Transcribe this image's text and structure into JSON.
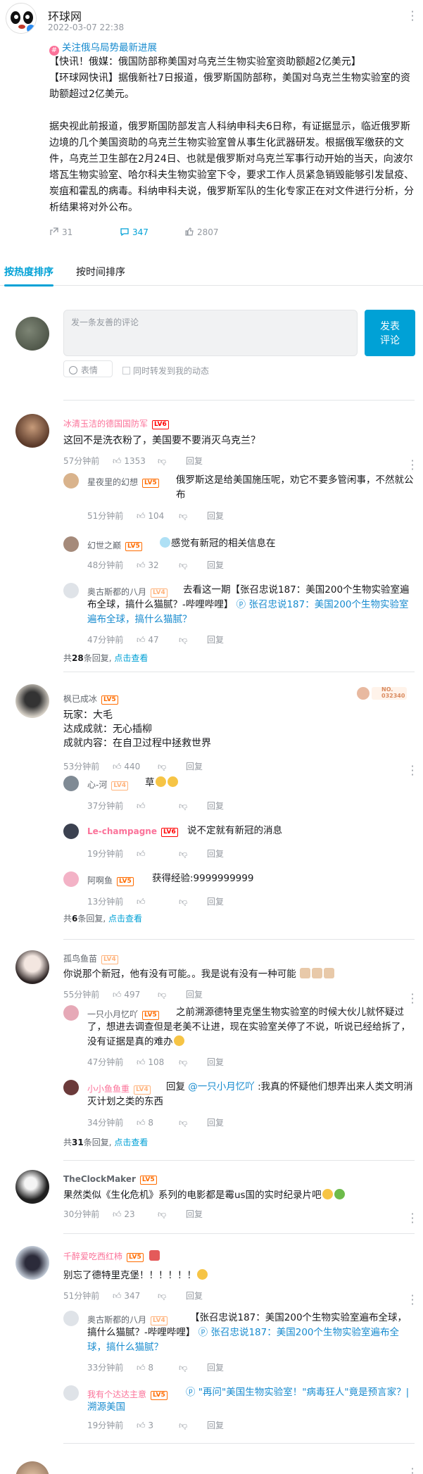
{
  "post": {
    "author": "环球网",
    "time": "2022-03-07 22:38",
    "topic": "关注俄乌局势最新进展",
    "text": "【快讯！俄媒：俄国防部称美国对乌克兰生物实验室资助额超2亿美元】\n【环球网快讯】据俄新社7日报道，俄罗斯国防部称，美国对乌克兰生物实验室的资助额超过2亿美元。\n\n据央视此前报道，俄罗斯国防部发言人科纳申科夫6日称，有证据显示，临近俄罗斯边境的几个美国资助的乌克兰生物实验室曾从事生化武器研发。根据俄军缴获的文件，乌克兰卫生部在2月24日、也就是俄罗斯对乌克兰军事行动开始的当天，向波尔塔瓦生物实验室、哈尔科夫生物实验室下令，要求工作人员紧急销毁能够引发鼠疫、炭疽和霍乱的病毒。科纳申科夫说，俄罗斯军队的生化专家正在对文件进行分析，分析结果将对外公布。",
    "shares": "31",
    "comments": "347",
    "likes": "2807"
  },
  "tabs": {
    "hot": "按热度排序",
    "time": "按时间排序"
  },
  "composer": {
    "placeholder": "发一条友善的评论",
    "submit": "发表\n评论",
    "emoji": "表情",
    "repost": "同时转发到我的动态"
  },
  "ui": {
    "reply": "回复"
  },
  "comments": [
    {
      "user": "冰清玉洁的德国国防军",
      "level": "LV6",
      "text": "这回不是洗衣粉了，美国要不要消灭乌克兰？",
      "time": "57分钟前",
      "likes": "1353",
      "replies": [
        {
          "user": "星夜里的幻想",
          "level": "LV5",
          "text": "俄罗斯这是给美国施压呢，劝它不要多管闲事，不然就公布",
          "time": "51分钟前",
          "likes": "104"
        },
        {
          "user": "幻世之巅",
          "level": "LV5",
          "text": "感觉有新冠的相关信息在",
          "time": "48分钟前",
          "likes": "32"
        },
        {
          "user": "奥古斯都的八月",
          "level": "LV4",
          "text": "去看这一期【张召忠说187：美国200个生物实验室遍布全球，搞什么猫腻？-哔哩哔哩】",
          "link": "张召忠说187：美国200个生物实验室遍布全球，搞什么猫腻？",
          "time": "47分钟前",
          "likes": "47"
        }
      ],
      "reply_count_prefix": "共",
      "reply_count": "28",
      "reply_count_suffix": "条回复,",
      "reply_view": "点击查看"
    },
    {
      "user": "枫已成冰",
      "level": "LV5",
      "badge": "NO.\n032340",
      "text": "玩家：大毛\n达成成就：无心插柳\n成就内容：在自卫过程中拯救世界",
      "time": "53分钟前",
      "likes": "440",
      "replies": [
        {
          "user": "心-河",
          "level": "LV4",
          "text": "草",
          "time": "37分钟前",
          "likes": ""
        },
        {
          "user": "Le-champagne",
          "level": "LV6",
          "text": "说不定就有新冠的消息",
          "time": "19分钟前",
          "likes": ""
        },
        {
          "user": "阿啊鱼",
          "level": "LV5",
          "text": "获得经验:9999999999",
          "time": "13分钟前",
          "likes": ""
        }
      ],
      "reply_count_prefix": "共",
      "reply_count": "6",
      "reply_count_suffix": "条回复,",
      "reply_view": "点击查看"
    },
    {
      "user": "孤鸟鱼苗",
      "level": "LV4",
      "text": "你说那个新冠，他有没有可能。。我是说有没有一种可能",
      "time": "55分钟前",
      "likes": "497",
      "replies": [
        {
          "user": "一只小月忆吖",
          "level": "LV5",
          "text": "之前溯源德特里克堡生物实验室的时候大伙儿就怀疑过了，想进去调查但是老美不让进，现在实验室关停了不说，听说已经给拆了，没有证据是真的难办",
          "time": "47分钟前",
          "likes": "108"
        },
        {
          "user": "小小鱼鱼重",
          "level": "LV4",
          "prefix": "回复 ",
          "mention": "@一只小月忆吖",
          "text": " :我真的怀疑他们想弄出来人类文明消灭计划之类的东西",
          "time": "34分钟前",
          "likes": "8"
        }
      ],
      "reply_count_prefix": "共",
      "reply_count": "31",
      "reply_count_suffix": "条回复,",
      "reply_view": "点击查看"
    },
    {
      "user": "TheClockMaker",
      "level": "LV5",
      "text": "果然类似《生化危机》系列的电影都是霉us国的实时纪录片吧",
      "time": "30分钟前",
      "likes": "23"
    },
    {
      "user": "千醉爱吃西红柿",
      "level": "LV5",
      "text": "别忘了德特里克堡！！！！！！",
      "time": "51分钟前",
      "likes": "347",
      "replies": [
        {
          "user": "奥古斯都的八月",
          "level": "LV4",
          "text": "【张召忠说187：美国200个生物实验室遍布全球，搞什么猫腻？-哔哩哔哩】",
          "link": "张召忠说187：美国200个生物实验室遍布全球，搞什么猫腻？",
          "time": "33分钟前",
          "likes": "8"
        },
        {
          "user": "我有个达达主意",
          "level": "LV5",
          "link": "\"再问\"美国生物实验室！\"病毒狂人\"竟是预言家？| 溯源美国",
          "text": "",
          "time": "19分钟前",
          "likes": "3"
        }
      ]
    }
  ],
  "colors": {
    "accent": "#00a1d6",
    "link": "#178bcf",
    "vip_name": "#fb7299"
  }
}
